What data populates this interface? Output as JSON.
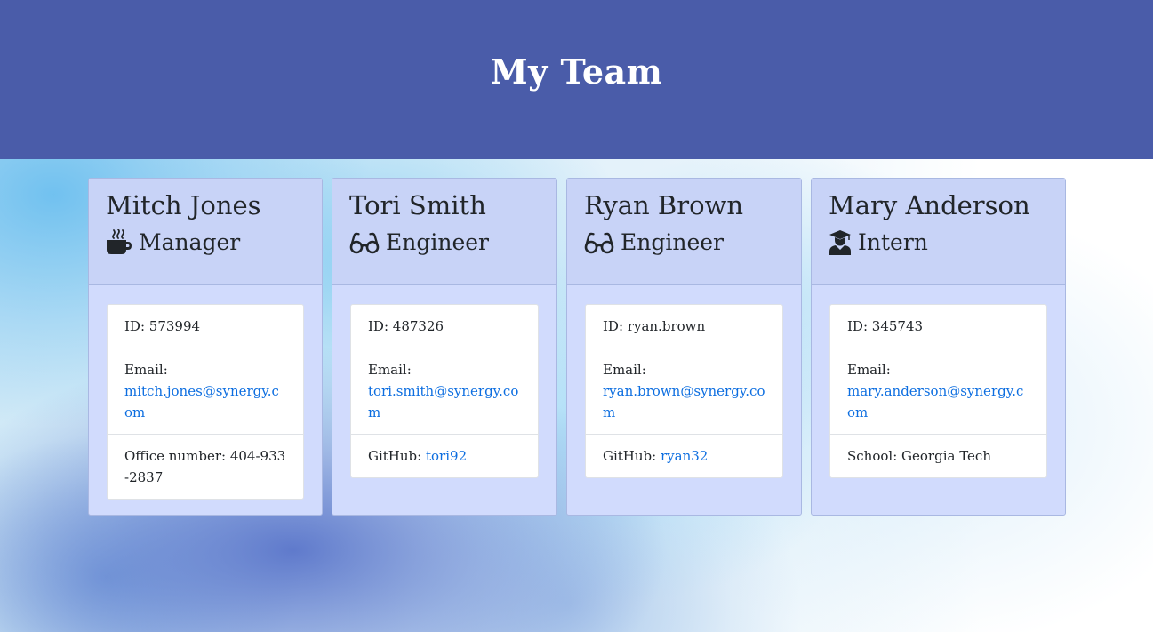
{
  "header": {
    "title": "My Team"
  },
  "colors": {
    "header_bg": "#4a5ca9",
    "card_bg": "#d1dbfd",
    "card_header_bg": "#c8d3f7",
    "link": "#0d6ee0"
  },
  "team": [
    {
      "name": "Mitch Jones",
      "role": "Manager",
      "icon": "coffee-mug-icon",
      "id_label": "ID:",
      "id": "573994",
      "email_label": "Email:",
      "email": "mitch.jones@synergy.com",
      "extra_label": "Office number:",
      "extra_value": "404-933-2837"
    },
    {
      "name": "Tori Smith",
      "role": "Engineer",
      "icon": "glasses-icon",
      "id_label": "ID:",
      "id": "487326",
      "email_label": "Email:",
      "email": "tori.smith@synergy.com",
      "extra_label": "GitHub:",
      "extra_value": "tori92"
    },
    {
      "name": "Ryan Brown",
      "role": "Engineer",
      "icon": "glasses-icon",
      "id_label": "ID:",
      "id": "ryan.brown",
      "email_label": "Email:",
      "email": "ryan.brown@synergy.com",
      "extra_label": "GitHub:",
      "extra_value": "ryan32"
    },
    {
      "name": "Mary Anderson",
      "role": "Intern",
      "icon": "graduate-icon",
      "id_label": "ID:",
      "id": "345743",
      "email_label": "Email:",
      "email": "mary.anderson@synergy.com",
      "extra_label": "School:",
      "extra_value": "Georgia Tech"
    }
  ]
}
